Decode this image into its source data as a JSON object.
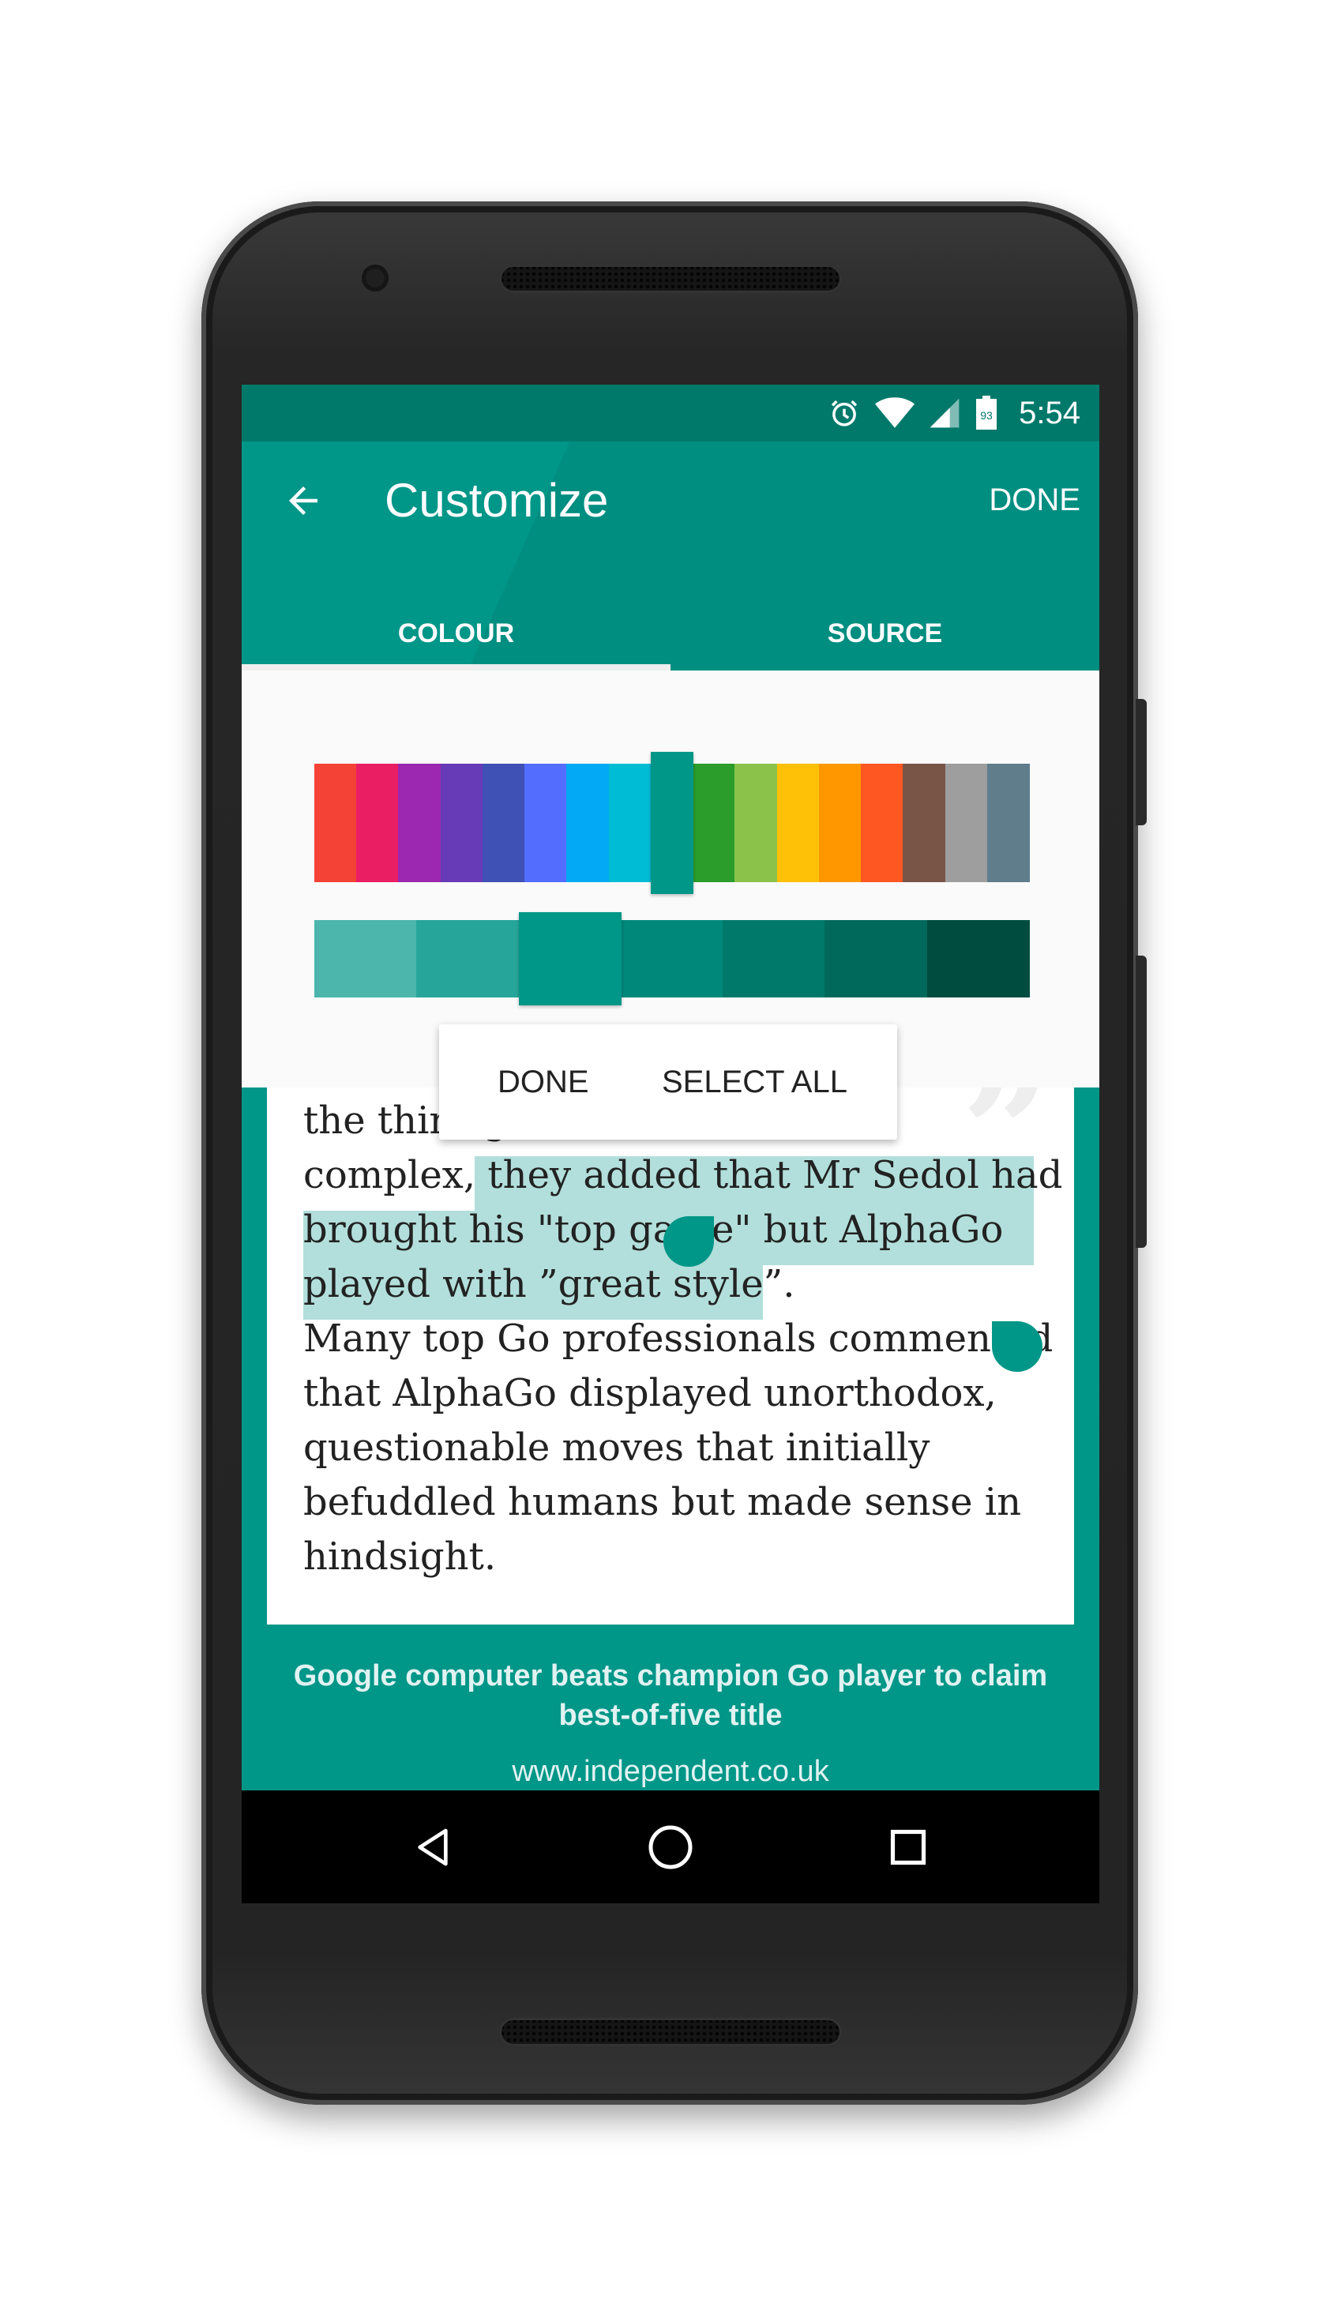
{
  "status_bar": {
    "time": "5:54",
    "icons": [
      "alarm-icon",
      "wifi-icon",
      "signal-icon",
      "battery-icon"
    ],
    "battery_level": "93"
  },
  "app_bar": {
    "title": "Customize",
    "done_label": "DONE",
    "back_icon": "arrow-back-icon",
    "tabs": [
      {
        "label": "COLOUR",
        "selected": true
      },
      {
        "label": "SOURCE",
        "selected": false
      }
    ]
  },
  "colour_picker": {
    "hues": [
      "#f44336",
      "#e91e63",
      "#9c27b0",
      "#673ab7",
      "#3f51b5",
      "#536dfe",
      "#03a9f4",
      "#00bcd4",
      "#009688",
      "#2a9d2a",
      "#8bc34a",
      "#ffc107",
      "#ff9800",
      "#ff5722",
      "#795548",
      "#9e9e9e",
      "#607d8b"
    ],
    "selected_hue": "#009688",
    "shades": [
      "#4db6ac",
      "#26a69a",
      "#009688",
      "#00897b",
      "#00796b",
      "#00695c",
      "#004d40"
    ],
    "selected_shade": "#009688"
  },
  "selection_menu": {
    "done_label": "DONE",
    "select_all_label": "SELECT ALL"
  },
  "article": {
    "lines": [
      "the third game had been",
      "complex, they added that Mr Sedol had",
      "brought his \"top game\" but AlphaGo",
      "played with ”great style”.",
      "Many top Go professionals commented",
      "that AlphaGo displayed unorthodox,",
      "questionable moves that initially",
      "befuddled humans but made sense in",
      "hindsight."
    ],
    "headline": "Google computer beats champion Go player to claim best-of-five title",
    "source": "www.independent.co.uk"
  },
  "nav_bar": {
    "icons": [
      "nav-back-icon",
      "nav-home-icon",
      "nav-recents-icon"
    ]
  },
  "colors": {
    "primary": "#009688",
    "primary_dark": "#00796b",
    "selection_highlight": "#b2dfdb"
  }
}
